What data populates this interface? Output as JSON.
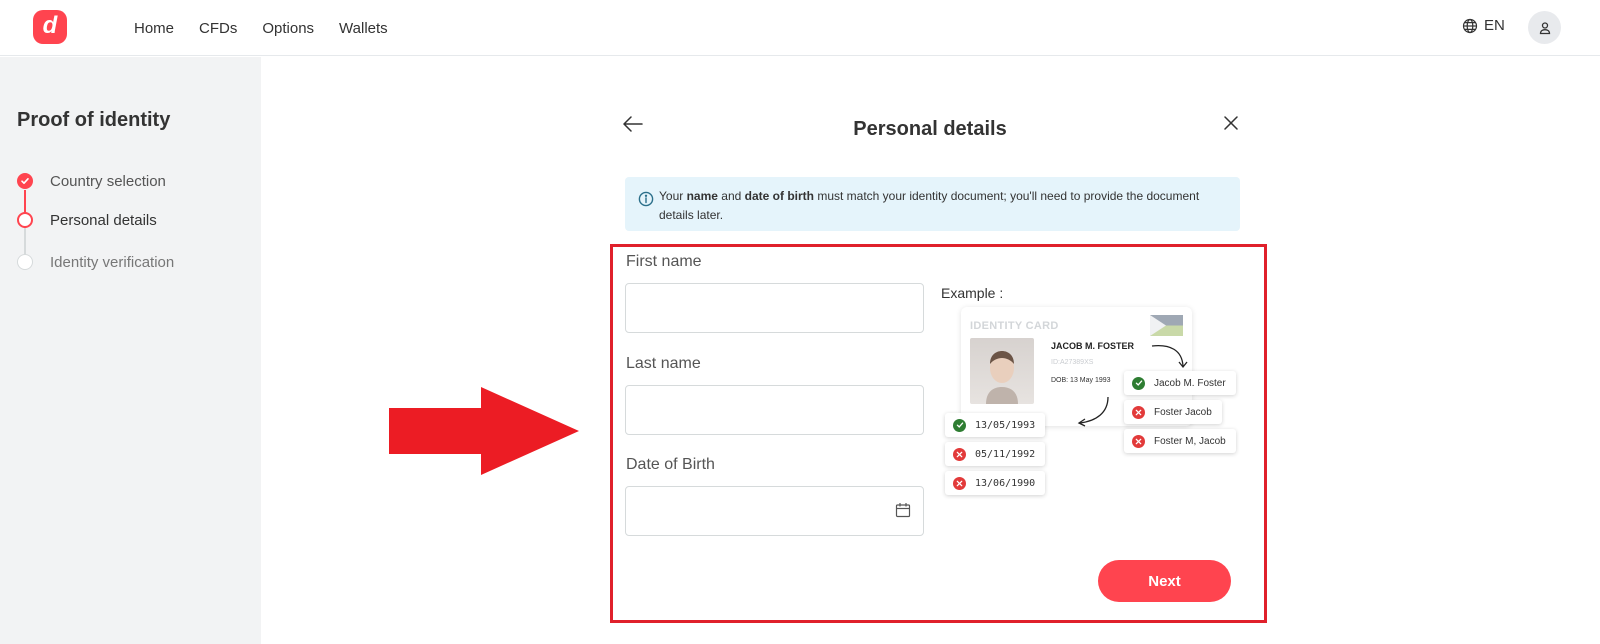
{
  "brand": {
    "logo_letter": "d",
    "accent": "#ff444f"
  },
  "nav": {
    "items": [
      "Home",
      "CFDs",
      "Options",
      "Wallets"
    ]
  },
  "header": {
    "language": "EN"
  },
  "sidebar": {
    "title": "Proof of identity",
    "steps": [
      {
        "label": "Country selection",
        "state": "done"
      },
      {
        "label": "Personal details",
        "state": "current"
      },
      {
        "label": "Identity verification",
        "state": "pending"
      }
    ]
  },
  "main": {
    "title": "Personal details",
    "info": {
      "pre": "Your ",
      "b1": "name",
      "mid": " and ",
      "b2": "date of birth",
      "post": " must match your identity document; you'll need to provide the document details later."
    },
    "fields": {
      "first_name": {
        "label": "First name",
        "value": ""
      },
      "last_name": {
        "label": "Last name",
        "value": ""
      },
      "dob": {
        "label": "Date of Birth",
        "value": ""
      }
    },
    "example": {
      "label": "Example :",
      "card": {
        "title": "IDENTITY CARD",
        "name": "JACOB M. FOSTER",
        "id": "ID:A27389XS",
        "dob": "DOB: 13 May 1993"
      },
      "name_examples": [
        {
          "text": "Jacob M. Foster",
          "valid": true
        },
        {
          "text": "Foster Jacob",
          "valid": false
        },
        {
          "text": "Foster M, Jacob",
          "valid": false
        }
      ],
      "dob_examples": [
        {
          "text": "13/05/1993",
          "valid": true
        },
        {
          "text": "05/11/1992",
          "valid": false
        },
        {
          "text": "13/06/1990",
          "valid": false
        }
      ]
    },
    "next_label": "Next"
  },
  "colors": {
    "highlight": "#e0202b",
    "valid": "#2e7d32",
    "invalid": "#e23a3a",
    "info_bg": "#e5f4fb"
  }
}
